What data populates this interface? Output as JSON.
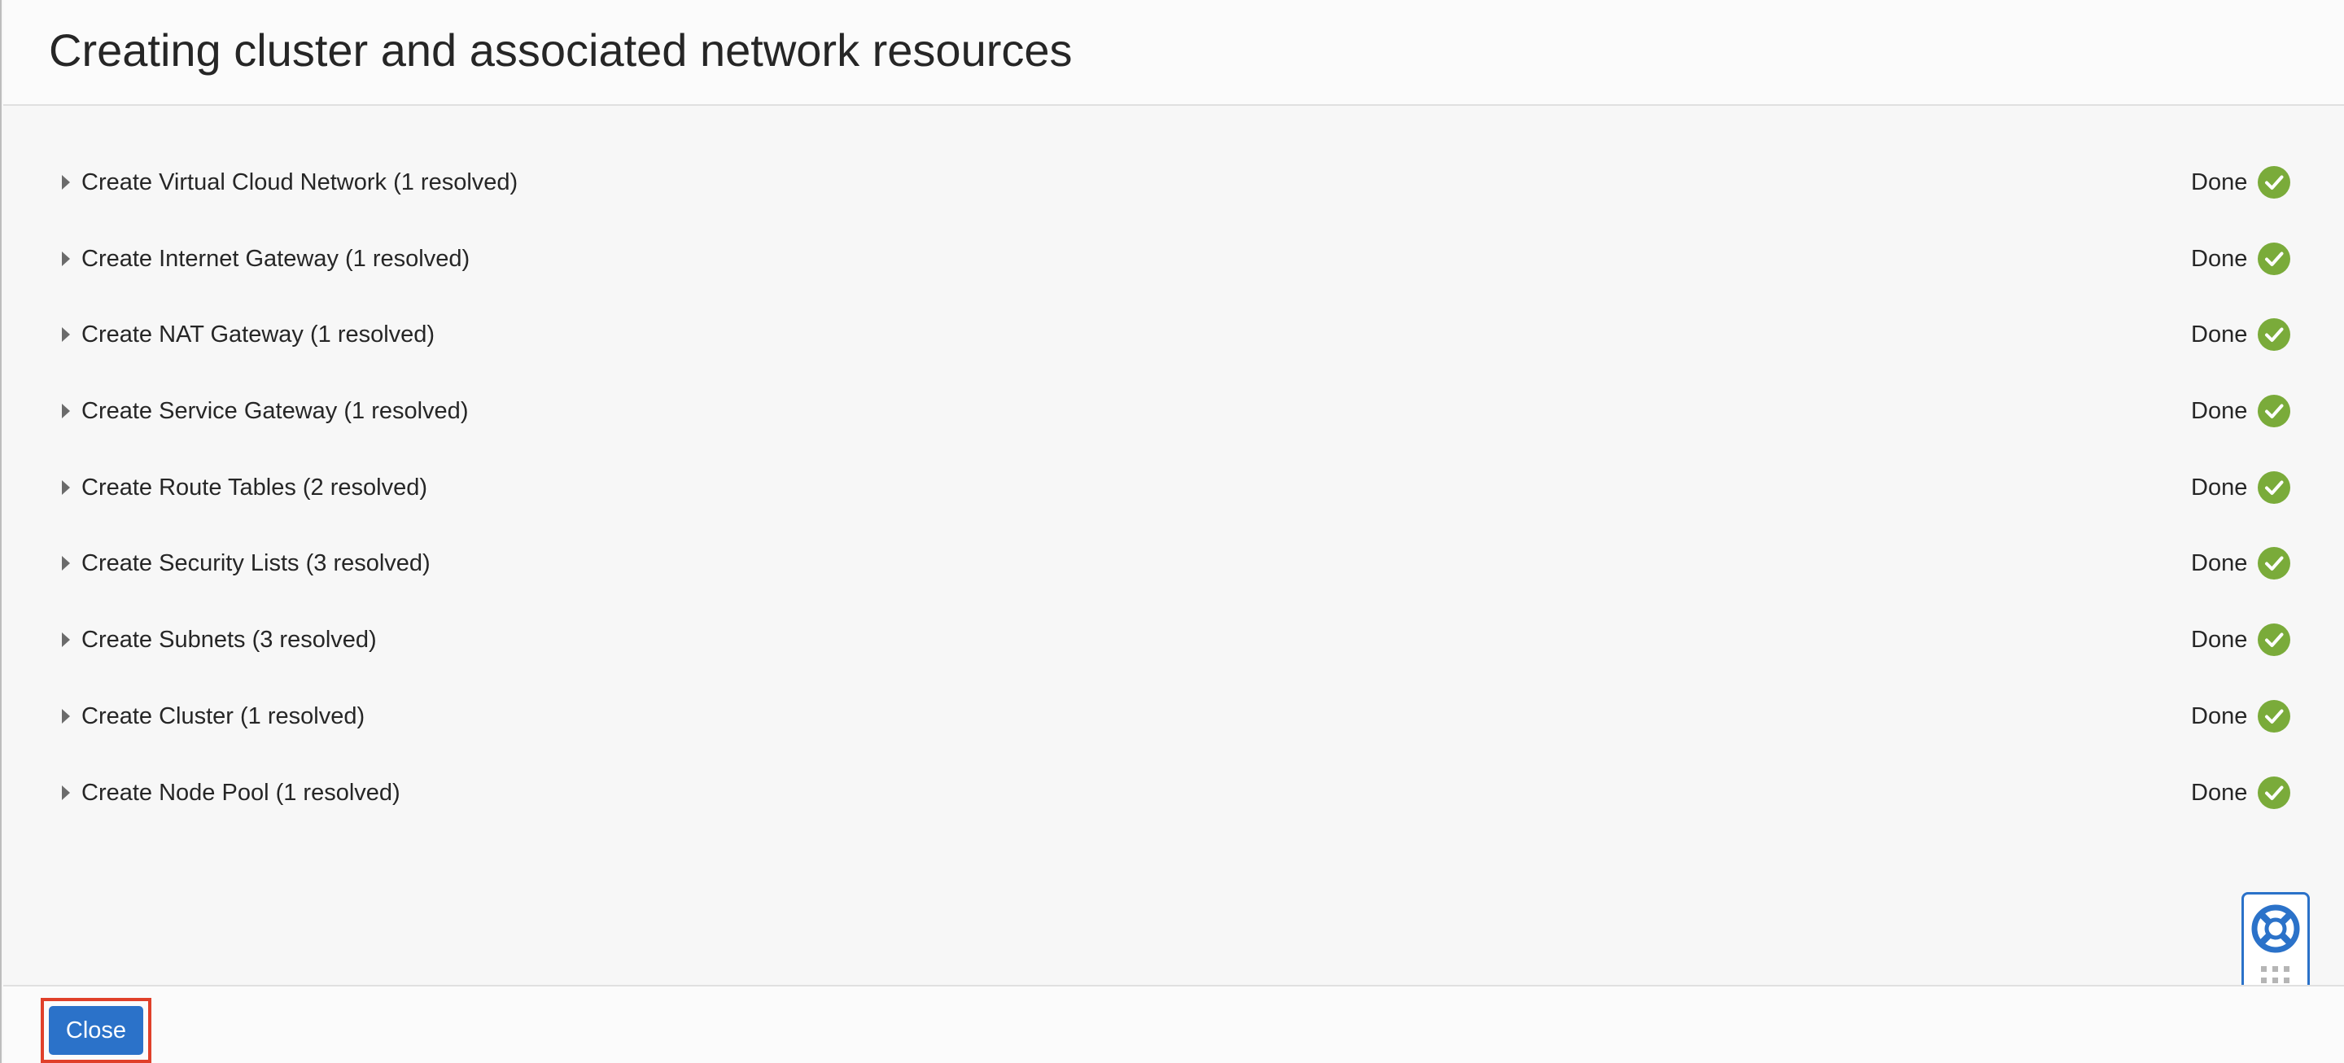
{
  "dialog": {
    "title": "Creating cluster and associated network resources"
  },
  "steps": [
    {
      "label": "Create Virtual Cloud Network (1 resolved)",
      "status": "Done"
    },
    {
      "label": "Create Internet Gateway (1 resolved)",
      "status": "Done"
    },
    {
      "label": "Create NAT Gateway (1 resolved)",
      "status": "Done"
    },
    {
      "label": "Create Service Gateway (1 resolved)",
      "status": "Done"
    },
    {
      "label": "Create Route Tables (2 resolved)",
      "status": "Done"
    },
    {
      "label": "Create Security Lists (3 resolved)",
      "status": "Done"
    },
    {
      "label": "Create Subnets (3 resolved)",
      "status": "Done"
    },
    {
      "label": "Create Cluster (1 resolved)",
      "status": "Done"
    },
    {
      "label": "Create Node Pool (1 resolved)",
      "status": "Done"
    }
  ],
  "icons": {
    "row_expander": "caret-right-icon",
    "status": "check-circle-icon",
    "help": "lifebuoy-icon"
  },
  "footer": {
    "close_label": "Close"
  },
  "colors": {
    "success": "#7aab3a",
    "primary_button": "#2b72c9",
    "highlight": "#e0402a"
  }
}
